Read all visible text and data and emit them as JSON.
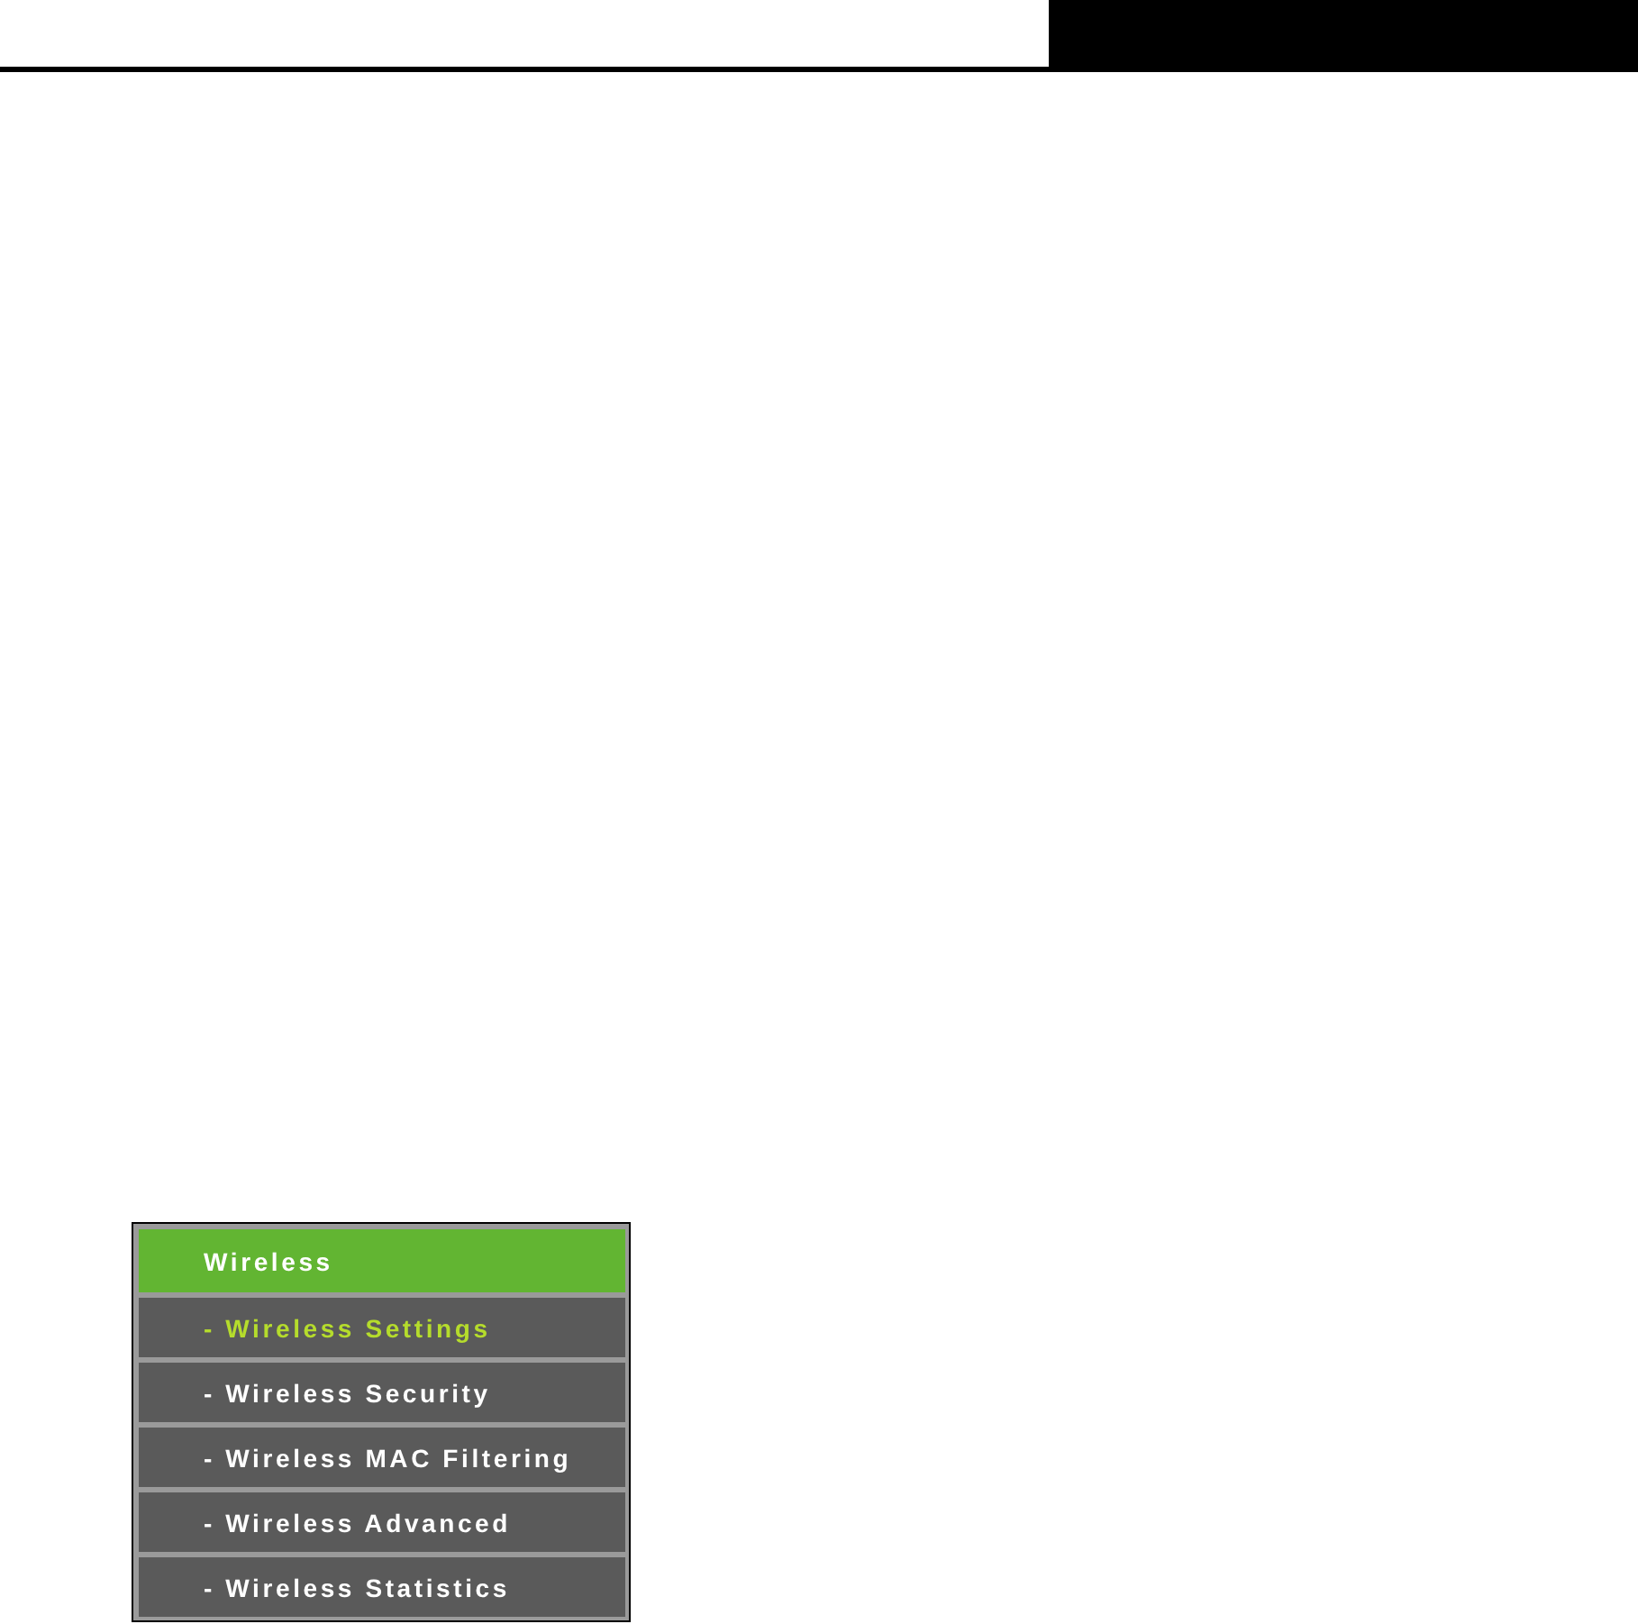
{
  "menu": {
    "title": "Wireless",
    "items": [
      {
        "label": "- Wireless Settings",
        "selected": true
      },
      {
        "label": "- Wireless Security",
        "selected": false
      },
      {
        "label": "- Wireless MAC Filtering",
        "selected": false
      },
      {
        "label": "- Wireless Advanced",
        "selected": false
      },
      {
        "label": "- Wireless Statistics",
        "selected": false
      }
    ]
  }
}
